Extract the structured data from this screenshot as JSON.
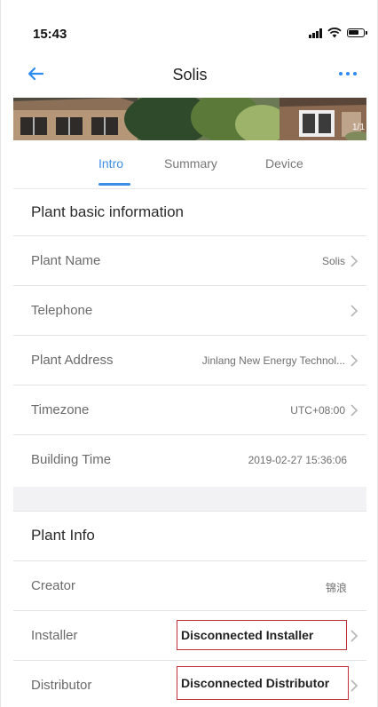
{
  "status": {
    "time": "15:43"
  },
  "nav": {
    "title": "Solis"
  },
  "tabs": [
    {
      "label": "Intro"
    },
    {
      "label": "Summary"
    },
    {
      "label": "Device"
    }
  ],
  "basic_info": {
    "title": "Plant basic information",
    "rows": [
      {
        "label": "Plant Name",
        "value": "Solis"
      },
      {
        "label": "Telephone",
        "value": ""
      },
      {
        "label": "Plant Address",
        "value": "Jinlang New Energy Technol..."
      },
      {
        "label": "Timezone",
        "value": "UTC+08:00"
      },
      {
        "label": "Building Time",
        "value": "2019-02-27 15:36:06"
      }
    ]
  },
  "plant_info": {
    "title": "Plant Info",
    "rows": [
      {
        "label": "Creator",
        "value": "锦浪"
      },
      {
        "label": "Installer",
        "value": "Disconnected Installer"
      },
      {
        "label": "Distributor",
        "value": "Disconnected Distributor"
      }
    ]
  },
  "banner": {
    "sign_text": "1/1"
  },
  "colors": {
    "accent": "#3b8ee6",
    "highlight_box": "#c0303a"
  },
  "icons": {
    "back": "arrow-left-icon",
    "more": "more-dots-icon",
    "chevron": "chevron-right-icon"
  }
}
